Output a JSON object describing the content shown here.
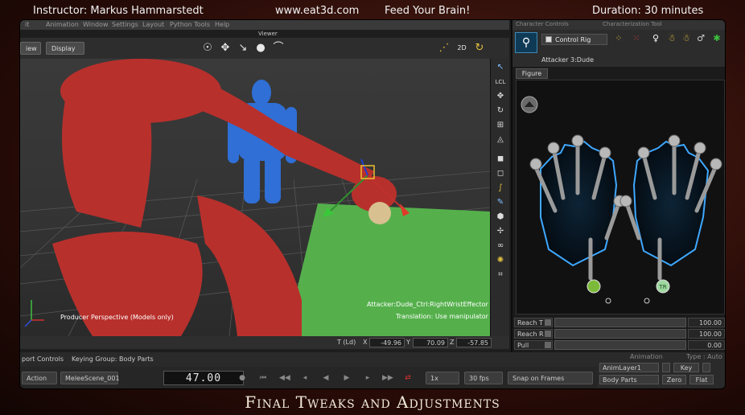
{
  "overlay": {
    "instructor": "Instructor: Markus Hammarstedt",
    "site": "www.eat3d.com",
    "slogan": "Feed Your Brain!",
    "duration": "Duration: 30 minutes",
    "footer_title": "Final Tweaks and Adjustments"
  },
  "menu": {
    "items": [
      "it",
      "Animation",
      "Window",
      "Settings",
      "Layout",
      "Python Tools",
      "Help"
    ]
  },
  "viewer": {
    "label": "Viewer",
    "view_button": "iew",
    "display_button": "Display",
    "tool_icons": [
      "orbit-icon",
      "translate-icon",
      "pan-icon",
      "select-icon",
      "rotate-icon"
    ]
  },
  "viewport": {
    "camera_label": "Producer Perspective (Models only)",
    "effector_label": "Attacker:Dude_Ctrl:RightWristEffector",
    "translation_label": "Translation: Use manipulator",
    "colors": {
      "red_char": "#b8302c",
      "blue_char": "#2f6fd6",
      "floor": "#55b04c",
      "ball": "#d8c090"
    }
  },
  "coords": {
    "mode": "T (Ld)",
    "x_label": "X",
    "x": "-49.96",
    "y_label": "Y",
    "y": "70.09",
    "z_label": "Z",
    "z": "-57.85"
  },
  "transport": {
    "controls_label": "port Controls",
    "keying_group": "Keying Group: Body Parts",
    "action": "Action",
    "scene": "MeleeScene_001",
    "frame": "47.00",
    "speed": "1x",
    "fps": "30 fps",
    "snap": "Snap on Frames"
  },
  "panel": {
    "tabs": [
      "Character Controls",
      "Characterization Tool"
    ],
    "rig": "Control Rig",
    "character": "Attacker 3:Dude",
    "figure_tab": "Figure",
    "hand_markers": [
      "TR",
      "TR"
    ],
    "reach_t_label": "Reach T",
    "reach_t": "100.00",
    "reach_r_label": "Reach R",
    "reach_r": "100.00",
    "pull_label": "Pull",
    "pull": "0.00"
  },
  "anim_panel": {
    "title": "Animation",
    "type": "Type : Auto",
    "layer": "AnimLayer1",
    "key": "Key",
    "body_parts": "Body Parts",
    "zero": "Zero",
    "flat": "Flat"
  }
}
